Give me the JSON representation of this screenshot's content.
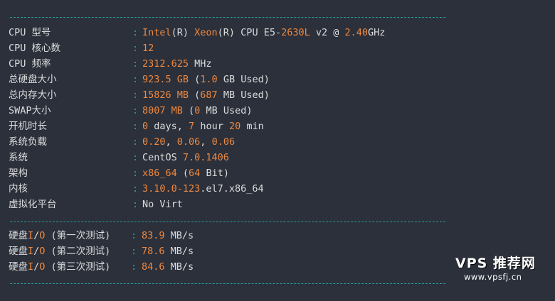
{
  "colors": {
    "background": "#2b303b",
    "text": "#dcdcdc",
    "highlight": "#f0883e",
    "divider": "#2aa198"
  },
  "system_info": [
    {
      "label": "CPU 型号",
      "segments": [
        [
          "Intel",
          true
        ],
        [
          "(R) ",
          false
        ],
        [
          "Xeon",
          true
        ],
        [
          "(R) CPU E5-",
          false
        ],
        [
          "2630L",
          true
        ],
        [
          " v2 @ ",
          false
        ],
        [
          "2.40",
          true
        ],
        [
          "GHz",
          false
        ]
      ]
    },
    {
      "label": "CPU 核心数",
      "segments": [
        [
          "12",
          true
        ]
      ]
    },
    {
      "label": "CPU 频率",
      "segments": [
        [
          "2312.625",
          true
        ],
        [
          " MHz",
          false
        ]
      ]
    },
    {
      "label": "总硬盘大小",
      "segments": [
        [
          "923.5 GB",
          true
        ],
        [
          " (",
          false
        ],
        [
          "1.0",
          true
        ],
        [
          " GB Used)",
          false
        ]
      ]
    },
    {
      "label": "总内存大小",
      "segments": [
        [
          "15826 MB",
          true
        ],
        [
          " (",
          false
        ],
        [
          "687",
          true
        ],
        [
          " MB Used)",
          false
        ]
      ]
    },
    {
      "label": "SWAP大小",
      "segments": [
        [
          "8007 MB",
          true
        ],
        [
          " (",
          false
        ],
        [
          "0",
          true
        ],
        [
          " MB Used)",
          false
        ]
      ]
    },
    {
      "label": "开机时长",
      "segments": [
        [
          "0",
          true
        ],
        [
          " days, ",
          false
        ],
        [
          "7",
          true
        ],
        [
          " hour ",
          false
        ],
        [
          "20",
          true
        ],
        [
          " min",
          false
        ]
      ]
    },
    {
      "label": "系统负载",
      "segments": [
        [
          "0.20",
          true
        ],
        [
          ", ",
          false
        ],
        [
          "0.06",
          true
        ],
        [
          ", ",
          false
        ],
        [
          "0.06",
          true
        ]
      ]
    },
    {
      "label": "系统",
      "segments": [
        [
          "CentOS ",
          false
        ],
        [
          "7.0.1406",
          true
        ]
      ]
    },
    {
      "label": "架构",
      "segments": [
        [
          "x86_64",
          true
        ],
        [
          " (",
          false
        ],
        [
          "64",
          true
        ],
        [
          " Bit)",
          false
        ]
      ]
    },
    {
      "label": "内核",
      "segments": [
        [
          "3.10.0-123",
          true
        ],
        [
          ".el7.x86_64",
          false
        ]
      ]
    },
    {
      "label": "虚拟化平台",
      "segments": [
        [
          "No Virt",
          false
        ]
      ]
    }
  ],
  "io_tests": [
    {
      "label_parts": [
        [
          "硬盘",
          false
        ],
        [
          "I",
          true
        ],
        [
          "/",
          false
        ],
        [
          "O",
          true
        ],
        [
          " (第一次测试)",
          false
        ]
      ],
      "segments": [
        [
          "83.9",
          true
        ],
        [
          " MB/s",
          false
        ]
      ]
    },
    {
      "label_parts": [
        [
          "硬盘",
          false
        ],
        [
          "I",
          true
        ],
        [
          "/",
          false
        ],
        [
          "O",
          true
        ],
        [
          " (第二次测试)",
          false
        ]
      ],
      "segments": [
        [
          "78.6",
          true
        ],
        [
          " MB/s",
          false
        ]
      ]
    },
    {
      "label_parts": [
        [
          "硬盘",
          false
        ],
        [
          "I",
          true
        ],
        [
          "/",
          false
        ],
        [
          "O",
          true
        ],
        [
          " (第三次测试)",
          false
        ]
      ],
      "segments": [
        [
          "84.6",
          true
        ],
        [
          " MB/s",
          false
        ]
      ]
    }
  ],
  "colon": ":",
  "watermark": {
    "title": "VPS 推荐网",
    "url": "www.vpsfj.cn"
  }
}
